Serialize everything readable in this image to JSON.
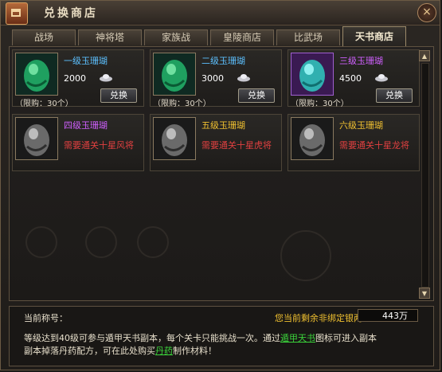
{
  "window": {
    "title": "兑换商店",
    "close_icon": "×"
  },
  "tabs": [
    {
      "label": "战场"
    },
    {
      "label": "神将塔"
    },
    {
      "label": "家族战"
    },
    {
      "label": "皇陵商店"
    },
    {
      "label": "比武场"
    },
    {
      "label": "天书商店",
      "active": true
    }
  ],
  "cards": [
    {
      "name": "一级玉珊瑚",
      "name_color": "#5cc0ff",
      "price": "2000",
      "limit": "（限购：30个）",
      "buy": "兑换",
      "icon": "green-jade-icon"
    },
    {
      "name": "二级玉珊瑚",
      "name_color": "#5cc0ff",
      "price": "3000",
      "limit": "（限购：30个）",
      "buy": "兑换",
      "icon": "green-jade-icon"
    },
    {
      "name": "三级玉珊瑚",
      "name_color": "#d060ff",
      "price": "4500",
      "limit": "（限购：30个）",
      "buy": "兑换",
      "icon": "teal-jade-icon"
    },
    {
      "name": "四级玉珊瑚",
      "name_color": "#d060ff",
      "requirement": "需要通关十星风将",
      "icon": "grey-jade-icon"
    },
    {
      "name": "五级玉珊瑚",
      "name_color": "#f0c030",
      "requirement": "需要通关十星虎将",
      "icon": "grey-jade-icon"
    },
    {
      "name": "六级玉珊瑚",
      "name_color": "#f0c030",
      "requirement": "需要通关十星龙将",
      "icon": "grey-jade-icon"
    }
  ],
  "footer": {
    "title_label": "当前称号：",
    "silver_label": "您当前剩余非绑定银两：",
    "silver_value": "443万",
    "desc_line1_a": "等级达到40级可参与遁甲天书副本，每个关卡只能挑战一次。通过",
    "desc_line1_link": "遁甲天书",
    "desc_line1_b": "图标可进入副本",
    "desc_line2_a": "副本掉落丹药配方，可在此处购买",
    "desc_line2_link": "丹药",
    "desc_line2_b": "制作材料！"
  }
}
